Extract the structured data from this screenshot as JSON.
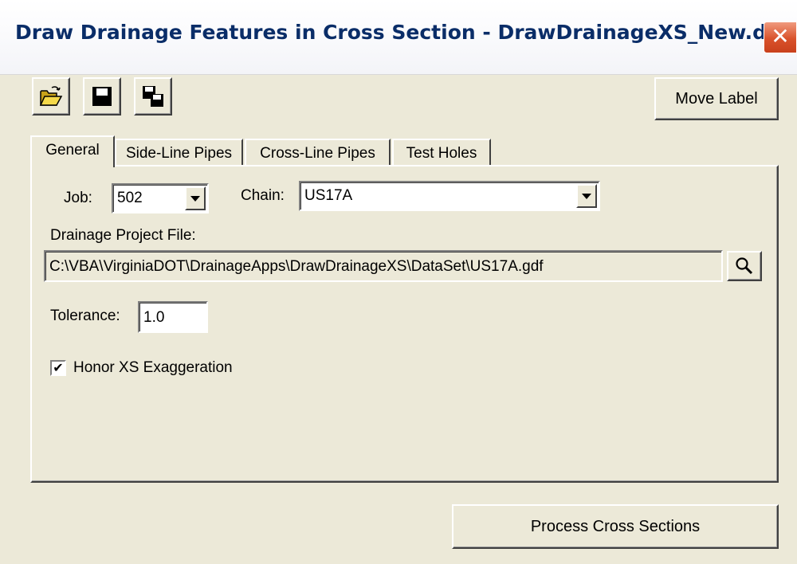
{
  "window": {
    "title": "Draw Drainage Features in Cross Section - DrawDrainageXS_New.dxs",
    "close_glyph": "✕"
  },
  "toolbar": {
    "open_icon": "open-folder-icon",
    "save_icon": "save-disk-icon",
    "save_as_icon": "save-as-disks-icon",
    "move_label": "Move Label"
  },
  "tabs": [
    {
      "label": "General",
      "active": true
    },
    {
      "label": "Side-Line Pipes",
      "active": false
    },
    {
      "label": "Cross-Line Pipes",
      "active": false
    },
    {
      "label": "Test Holes",
      "active": false
    }
  ],
  "general": {
    "job_label": "Job:",
    "job_value": "502",
    "chain_label": "Chain:",
    "chain_value": "US17A",
    "project_file_label": "Drainage Project File:",
    "project_file_value": "C:\\VBA\\VirginiaDOT\\DrainageApps\\DrawDrainageXS\\DataSet\\US17A.gdf",
    "browse_icon": "magnifier-icon",
    "tolerance_label": "Tolerance:",
    "tolerance_value": "1.0",
    "honor_xs_label": "Honor XS Exaggeration",
    "honor_xs_checked": true,
    "check_glyph": "✔"
  },
  "actions": {
    "process_label": "Process Cross Sections"
  },
  "colors": {
    "title_text": "#0a2d68",
    "dialog_bg": "#ece9d8",
    "close_button": "#d9522b"
  }
}
